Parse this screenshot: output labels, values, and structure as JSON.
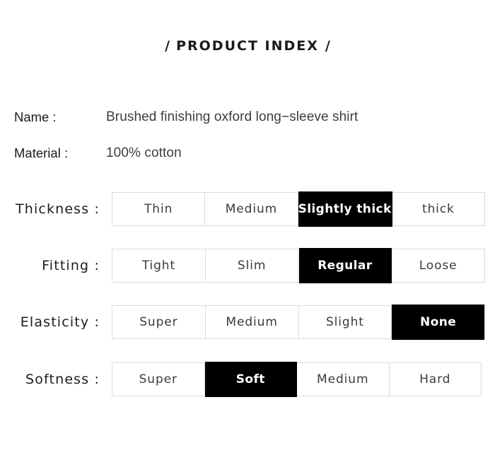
{
  "header": {
    "slash_left": "/",
    "title": "PRODUCT INDEX",
    "slash_right": "/"
  },
  "info": [
    {
      "label": "Name :",
      "value": "Brushed finishing oxford long−sleeve shirt"
    },
    {
      "label": "Material :",
      "value": "100% cotton"
    }
  ],
  "options": [
    {
      "label": "Thickness :",
      "cells": [
        {
          "text": "Thin",
          "selected": false
        },
        {
          "text": "Medium",
          "selected": false
        },
        {
          "text": "Slightly thick",
          "selected": true
        },
        {
          "text": "thick",
          "selected": false
        }
      ]
    },
    {
      "label": "Fitting  :",
      "cells": [
        {
          "text": "Tight",
          "selected": false
        },
        {
          "text": "Slim",
          "selected": false
        },
        {
          "text": "Regular",
          "selected": true
        },
        {
          "text": "Loose",
          "selected": false
        }
      ]
    },
    {
      "label": "Elasticity :",
      "cells": [
        {
          "text": "Super",
          "selected": false
        },
        {
          "text": "Medium",
          "selected": false
        },
        {
          "text": "Slight",
          "selected": false
        },
        {
          "text": "None",
          "selected": true
        }
      ]
    },
    {
      "label": "Softness :",
      "cells": [
        {
          "text": "Super",
          "selected": false
        },
        {
          "text": "Soft",
          "selected": true
        },
        {
          "text": "Medium",
          "selected": false
        },
        {
          "text": "Hard",
          "selected": false
        }
      ]
    }
  ],
  "colors": {
    "page_background": "#ffffff",
    "selected_background": "#000000",
    "selected_text": "#ffffff",
    "cell_border": "#dcdcdc",
    "label_text": "#1c1c1c",
    "value_text": "#3d3d3d"
  }
}
